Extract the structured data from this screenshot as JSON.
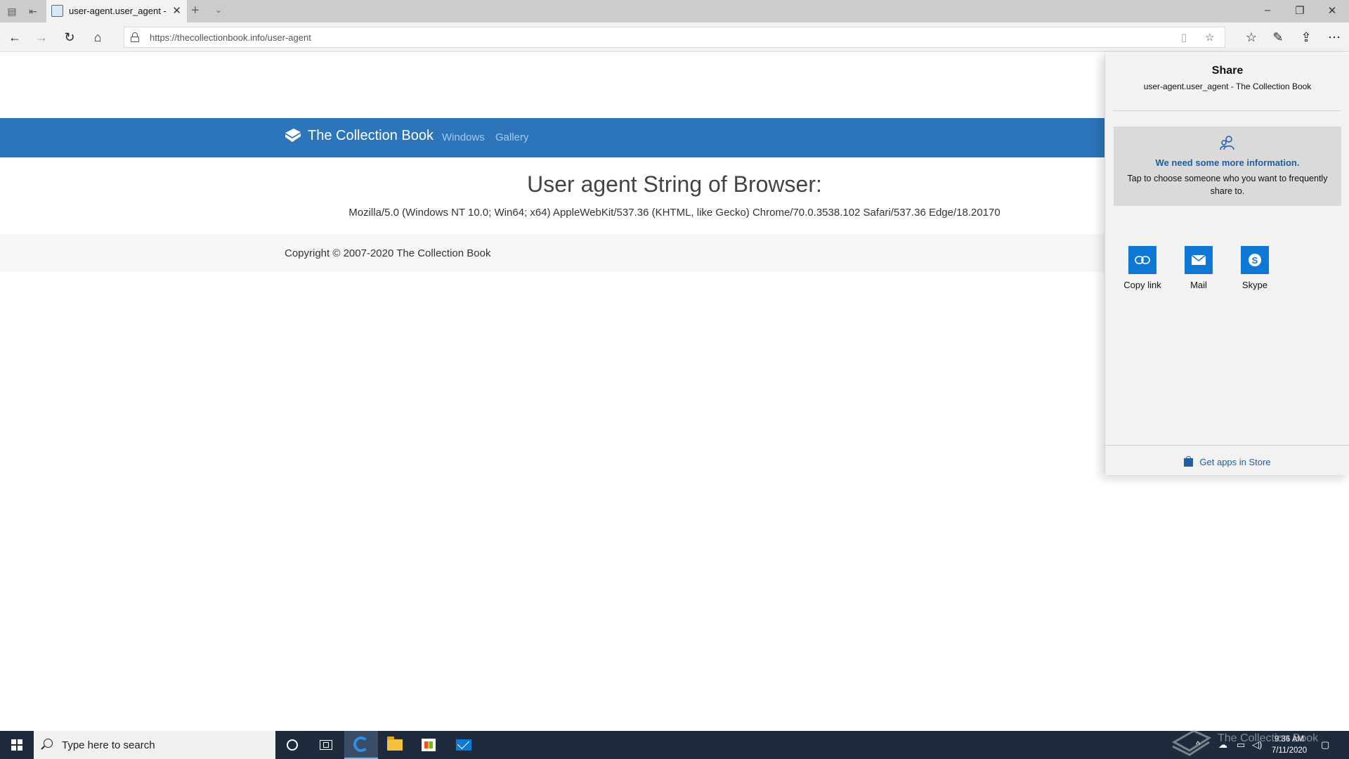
{
  "browser": {
    "tab_title": "user-agent.user_agent -",
    "url_host": "https://thecollectionbook.info",
    "url_path": "/user-agent"
  },
  "page": {
    "brand": "The Collection Book",
    "nav_links": [
      "Windows",
      "Gallery"
    ],
    "heading": "User agent String of Browser:",
    "ua_string": "Mozilla/5.0 (Windows NT 10.0; Win64; x64) AppleWebKit/537.36 (KHTML, like Gecko) Chrome/70.0.3538.102 Safari/537.36 Edge/18.20170",
    "footer": "Copyright © 2007-2020 The Collection Book"
  },
  "share": {
    "title": "Share",
    "subtitle": "user-agent.user_agent - The Collection Book",
    "info_heading": "We need some more information.",
    "info_body": "Tap to choose someone who you want to frequently share to.",
    "apps": [
      {
        "label": "Copy link",
        "icon": "link-icon"
      },
      {
        "label": "Mail",
        "icon": "mail-icon"
      },
      {
        "label": "Skype",
        "icon": "skype-icon"
      }
    ],
    "store_link": "Get apps in Store"
  },
  "taskbar": {
    "search_placeholder": "Type here to search",
    "time": "9:36 AM",
    "date": "7/11/2020"
  },
  "watermark": "The Collection Book",
  "colors": {
    "accent_blue": "#2d75bb",
    "tile_blue": "#0f78d4",
    "taskbar": "#1e2b3c"
  }
}
